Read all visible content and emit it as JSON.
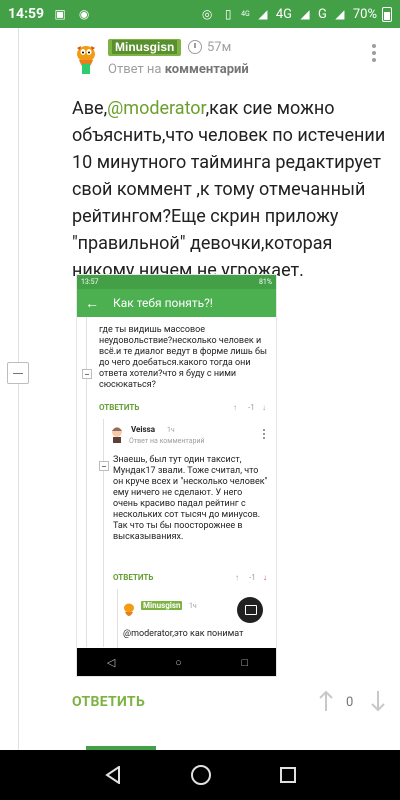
{
  "status_bar": {
    "time": "14:59",
    "network_1": "4G",
    "network_2": "4G",
    "lte_small": "4G",
    "battery": "70%"
  },
  "comment": {
    "username": "Minusgisn",
    "time_ago": "57м",
    "reply_prefix": "Ответ на",
    "reply_target": "комментарий",
    "mention": "@moderator",
    "text_before": "Аве,",
    "text_after": ",как сие можно объяснить,что человек по истечении 10 минутного тайминга редактирует свой коммент ,к тому отмечанный рейтингом?Еще скрин приложу \"правильной\" девочки,которая никому ничем не угрожает."
  },
  "embedded_screenshot": {
    "status_time": "13:57",
    "status_right": "81%",
    "title": "Как тебя понять?!",
    "first_comment": "где ты видишь массовое неудовольствие?несколько человек и всё.и те диалог ведут в форме лишь бы до чего доебаться.какого тогда они ответа хотели?что я буду с ними сюсюкаться?",
    "reply_label": "ОТВЕТИТЬ",
    "first_score": "-1",
    "second_user": "Veissa",
    "second_time": "1ч",
    "second_reply_prefix": "Ответ на",
    "second_reply_target": "комментарий",
    "second_comment": "Знаешь, был тут один таксист, Мундак17 звали. Тоже считал, что он круче всех и \"несколько человек\" ему ничего не сделают. У него очень красиво падал рейтинг с нескольких сот тысяч до минусов. Так что ты бы поосторожнее в высказываниях.",
    "second_score": "-1",
    "third_user": "Minusgisn",
    "third_time": "1ч",
    "third_comment": "@moderator,это как понимат"
  },
  "actions": {
    "reply_label": "ОТВЕТИТЬ",
    "score": "0"
  }
}
